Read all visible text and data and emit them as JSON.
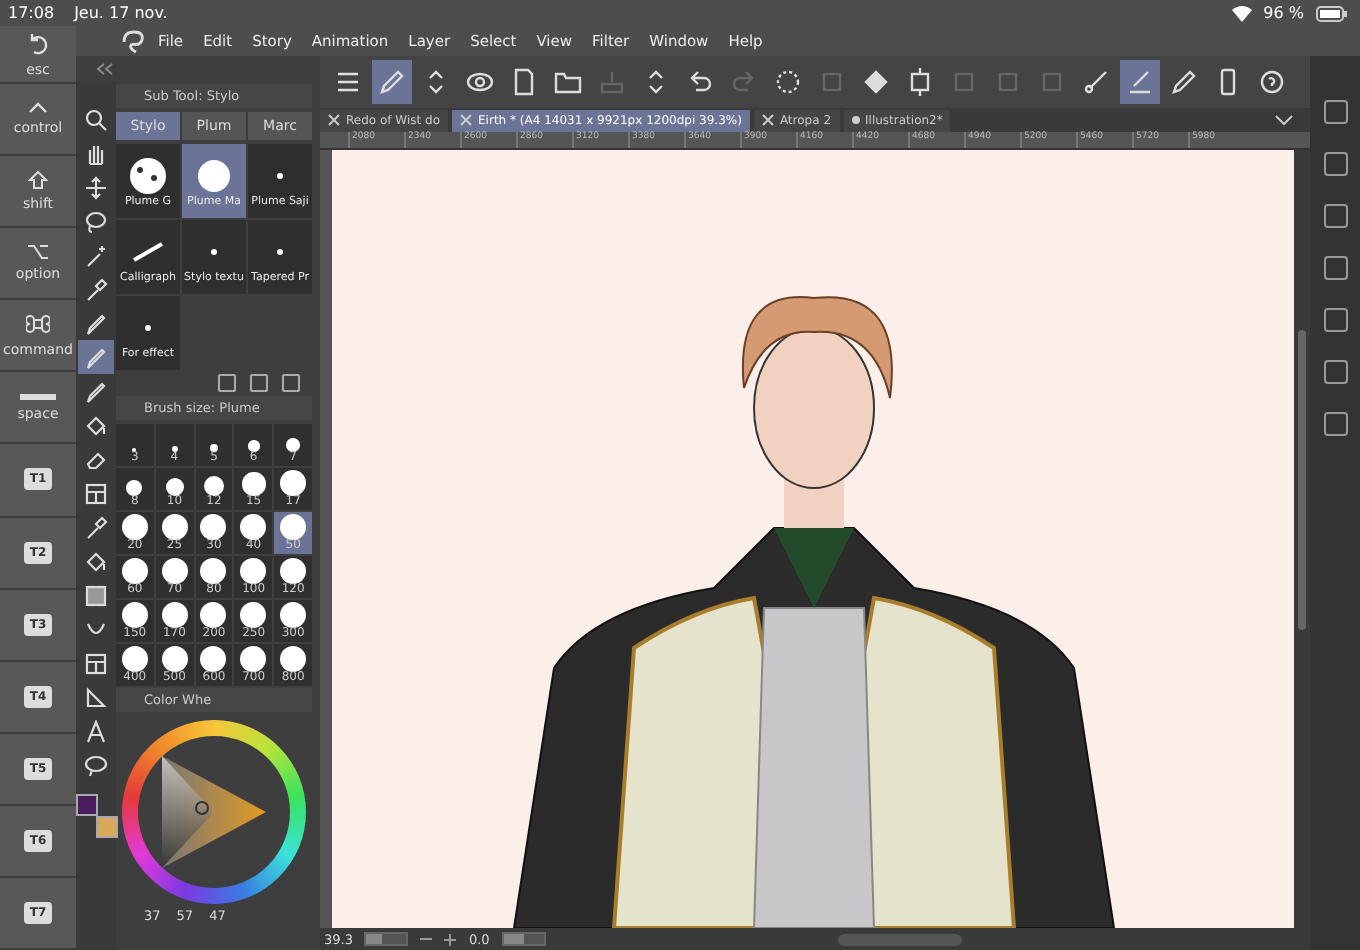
{
  "status_bar": {
    "time": "17:08",
    "date": "Jeu. 17 nov.",
    "battery": "96 %"
  },
  "keys": [
    {
      "label": "esc",
      "kind": "undo"
    },
    {
      "label": "control",
      "kind": "caret"
    },
    {
      "label": "shift",
      "kind": "shift"
    },
    {
      "label": "option",
      "kind": "option"
    },
    {
      "label": "command",
      "kind": "command"
    },
    {
      "label": "space",
      "kind": "space"
    },
    {
      "label": "T1",
      "kind": "t"
    },
    {
      "label": "T2",
      "kind": "t"
    },
    {
      "label": "T3",
      "kind": "t"
    },
    {
      "label": "T4",
      "kind": "t"
    },
    {
      "label": "T5",
      "kind": "t"
    },
    {
      "label": "T6",
      "kind": "t"
    },
    {
      "label": "T7",
      "kind": "t"
    }
  ],
  "menu": [
    "File",
    "Edit",
    "Story",
    "Animation",
    "Layer",
    "Select",
    "View",
    "Filter",
    "Window",
    "Help"
  ],
  "toolbar": [
    {
      "kind": "menu",
      "selected": false,
      "disabled": false
    },
    {
      "kind": "pen",
      "selected": true,
      "disabled": false
    },
    {
      "kind": "updown",
      "selected": false,
      "disabled": false
    },
    {
      "kind": "eye",
      "selected": false,
      "disabled": false
    },
    {
      "kind": "file",
      "selected": false,
      "disabled": false
    },
    {
      "kind": "folder",
      "selected": false,
      "disabled": false
    },
    {
      "kind": "save",
      "selected": false,
      "disabled": true
    },
    {
      "kind": "updown",
      "selected": false,
      "disabled": false
    },
    {
      "kind": "undo",
      "selected": false,
      "disabled": false
    },
    {
      "kind": "redo",
      "selected": false,
      "disabled": true
    },
    {
      "kind": "spinner",
      "selected": false,
      "disabled": false
    },
    {
      "kind": "square",
      "selected": false,
      "disabled": true
    },
    {
      "kind": "bucket",
      "selected": false,
      "disabled": false
    },
    {
      "kind": "transform",
      "selected": false,
      "disabled": false
    },
    {
      "kind": "square",
      "selected": false,
      "disabled": true
    },
    {
      "kind": "square",
      "selected": false,
      "disabled": true
    },
    {
      "kind": "square",
      "selected": false,
      "disabled": true
    },
    {
      "kind": "line",
      "selected": false,
      "disabled": false
    },
    {
      "kind": "brush",
      "selected": true,
      "disabled": false
    },
    {
      "kind": "pen",
      "selected": false,
      "disabled": false
    },
    {
      "kind": "phone",
      "selected": false,
      "disabled": false
    },
    {
      "kind": "help",
      "selected": false,
      "disabled": false
    }
  ],
  "tools": [
    {
      "kind": "search",
      "selected": false
    },
    {
      "kind": "hand",
      "selected": false
    },
    {
      "kind": "move",
      "selected": false
    },
    {
      "kind": "lasso",
      "selected": false
    },
    {
      "kind": "wand",
      "selected": false
    },
    {
      "kind": "dropper",
      "selected": false
    },
    {
      "kind": "pen",
      "selected": false
    },
    {
      "kind": "pen",
      "selected": true
    },
    {
      "kind": "pen",
      "selected": false
    },
    {
      "kind": "bucket",
      "selected": false
    },
    {
      "kind": "eraser",
      "selected": false
    },
    {
      "kind": "grid",
      "selected": false
    },
    {
      "kind": "dropper",
      "selected": false
    },
    {
      "kind": "bucket",
      "selected": false
    },
    {
      "kind": "gradient",
      "selected": false
    },
    {
      "kind": "curve",
      "selected": false
    },
    {
      "kind": "grid",
      "selected": false
    },
    {
      "kind": "ruler",
      "selected": false
    },
    {
      "kind": "text",
      "selected": false
    },
    {
      "kind": "balloon",
      "selected": false
    }
  ],
  "sub_tool_panel": {
    "title": "Sub Tool: Stylo",
    "tabs": [
      {
        "label": "Stylo",
        "selected": true
      },
      {
        "label": "Plum",
        "selected": false
      },
      {
        "label": "Marc",
        "selected": false
      }
    ],
    "brushes": [
      {
        "label": "Plume G",
        "kind": "splatter",
        "selected": false
      },
      {
        "label": "Plume Ma",
        "kind": "dot",
        "selected": true
      },
      {
        "label": "Plume Saji",
        "kind": "small",
        "selected": false
      },
      {
        "label": "Calligraph",
        "kind": "stroke",
        "selected": false
      },
      {
        "label": "Stylo textu",
        "kind": "small",
        "selected": false
      },
      {
        "label": "Tapered Pr",
        "kind": "small",
        "selected": false
      },
      {
        "label": "For effect",
        "kind": "small",
        "selected": false
      }
    ]
  },
  "brush_size_panel": {
    "title": "Brush size: Plume",
    "sizes": [
      {
        "label": "3",
        "selected": false
      },
      {
        "label": "4",
        "selected": false
      },
      {
        "label": "5",
        "selected": false
      },
      {
        "label": "6",
        "selected": false
      },
      {
        "label": "7",
        "selected": false
      },
      {
        "label": "8",
        "selected": false
      },
      {
        "label": "10",
        "selected": false
      },
      {
        "label": "12",
        "selected": false
      },
      {
        "label": "15",
        "selected": false
      },
      {
        "label": "17",
        "selected": false
      },
      {
        "label": "20",
        "selected": false
      },
      {
        "label": "25",
        "selected": false
      },
      {
        "label": "30",
        "selected": false
      },
      {
        "label": "40",
        "selected": false
      },
      {
        "label": "50",
        "selected": true
      },
      {
        "label": "60",
        "selected": false
      },
      {
        "label": "70",
        "selected": false
      },
      {
        "label": "80",
        "selected": false
      },
      {
        "label": "100",
        "selected": false
      },
      {
        "label": "120",
        "selected": false
      },
      {
        "label": "150",
        "selected": false
      },
      {
        "label": "170",
        "selected": false
      },
      {
        "label": "200",
        "selected": false
      },
      {
        "label": "250",
        "selected": false
      },
      {
        "label": "300",
        "selected": false
      },
      {
        "label": "400",
        "selected": false
      },
      {
        "label": "500",
        "selected": false
      },
      {
        "label": "600",
        "selected": false
      },
      {
        "label": "700",
        "selected": false
      },
      {
        "label": "800",
        "selected": false
      }
    ]
  },
  "color_panel": {
    "title": "Color Whe",
    "readouts": [
      "37",
      "57",
      "47"
    ],
    "swatches": [
      {
        "kind": "main",
        "color": "#4b1d5e"
      },
      {
        "kind": "sub",
        "color": "#d8a95a"
      }
    ]
  },
  "document_tabs": [
    {
      "label": "Redo of Wist do",
      "selected": false,
      "modified": false
    },
    {
      "label": "Eirth * (A4 14031 x 9921px 1200dpi 39.3%)",
      "selected": true,
      "modified": false
    },
    {
      "label": "Atropa 2",
      "selected": false,
      "modified": false
    },
    {
      "label": "Illustration2*",
      "selected": false,
      "modified": true
    }
  ],
  "ruler": [
    "2080",
    "2340",
    "2600",
    "2860",
    "3120",
    "3380",
    "3640",
    "3900",
    "4160",
    "4420",
    "4680",
    "4940",
    "5200",
    "5460",
    "5720",
    "5980"
  ],
  "bottom_bar": {
    "zoom": "39.3",
    "angle": "0.0",
    "zoom_slider": {
      "level": 0.4
    },
    "rotation_slider": {
      "level": 0.5
    }
  }
}
